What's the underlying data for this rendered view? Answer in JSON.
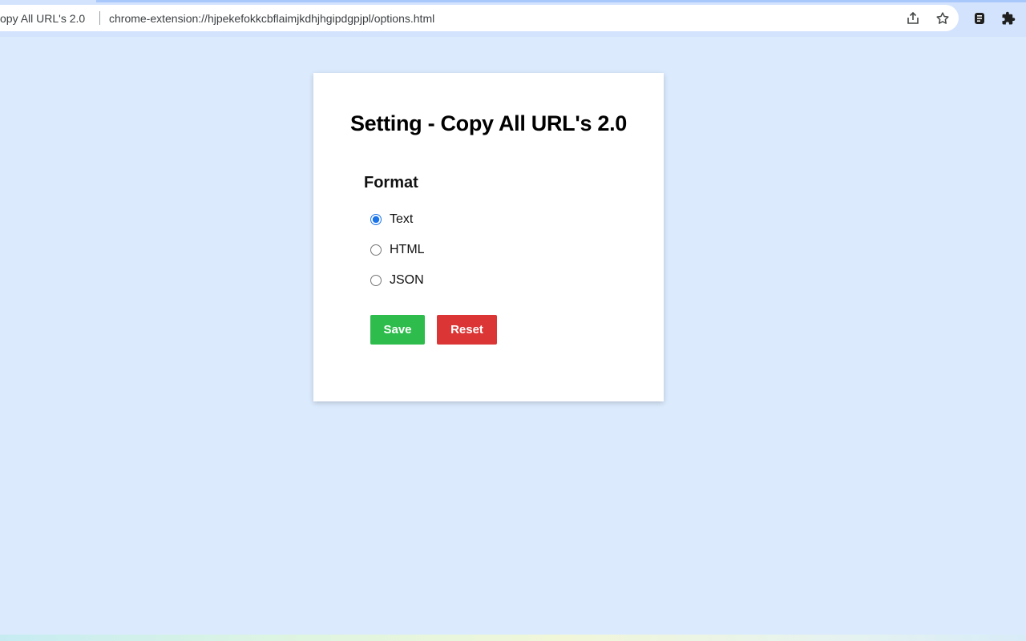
{
  "browser": {
    "site_name": "opy All URL's 2.0",
    "url": "chrome-extension://hjpekefokkcbflaimjkdhjhgipdgpjpl/options.html",
    "icons": {
      "share": "share-icon",
      "bookmark": "star-icon",
      "extension": "extension-icon",
      "extensions_menu": "puzzle-icon"
    }
  },
  "settings": {
    "title": "Setting - Copy All URL's 2.0",
    "format_label": "Format",
    "options": [
      {
        "label": "Text",
        "selected": true
      },
      {
        "label": "HTML",
        "selected": false
      },
      {
        "label": "JSON",
        "selected": false
      }
    ],
    "save_label": "Save",
    "reset_label": "Reset"
  },
  "colors": {
    "page_background": "#dbeafd",
    "save_button": "#2ebd4c",
    "reset_button": "#dc3535",
    "radio_accent": "#1a73e8"
  }
}
